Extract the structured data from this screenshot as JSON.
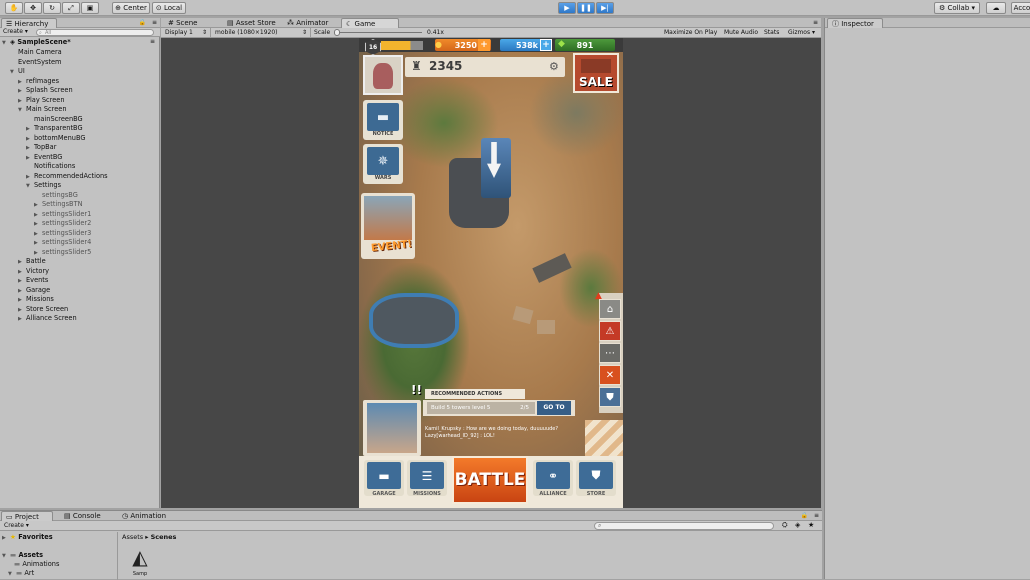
{
  "toolbar": {
    "center_label": "Center",
    "local_label": "Local",
    "collab_label": "Collab",
    "account_label": "Acco"
  },
  "hierarchy": {
    "tab": "Hierarchy",
    "create": "Create",
    "search_placeholder": "All",
    "scene": "SampleScene*",
    "rows": [
      {
        "label": "Main Camera",
        "indent": 1,
        "arrow": ""
      },
      {
        "label": "EventSystem",
        "indent": 1,
        "arrow": ""
      },
      {
        "label": "UI",
        "indent": 1,
        "arrow": "▼"
      },
      {
        "label": "refImages",
        "indent": 2,
        "arrow": "▶"
      },
      {
        "label": "Splash Screen",
        "indent": 2,
        "arrow": "▶"
      },
      {
        "label": "Play Screen",
        "indent": 2,
        "arrow": "▶"
      },
      {
        "label": "Main Screen",
        "indent": 2,
        "arrow": "▼"
      },
      {
        "label": "mainScreenBG",
        "indent": 3,
        "arrow": ""
      },
      {
        "label": "TransparentBG",
        "indent": 3,
        "arrow": "▶"
      },
      {
        "label": "bottomMenuBG",
        "indent": 3,
        "arrow": "▶"
      },
      {
        "label": "TopBar",
        "indent": 3,
        "arrow": "▶"
      },
      {
        "label": "EventBG",
        "indent": 3,
        "arrow": "▶"
      },
      {
        "label": "Notifications",
        "indent": 3,
        "arrow": ""
      },
      {
        "label": "RecommendedActions",
        "indent": 3,
        "arrow": "▶"
      },
      {
        "label": "Settings",
        "indent": 3,
        "arrow": "▼"
      },
      {
        "label": "settingsBG",
        "indent": 4,
        "arrow": ""
      },
      {
        "label": "SettingsBTN",
        "indent": 4,
        "arrow": "▶"
      },
      {
        "label": "settingsSlider1",
        "indent": 4,
        "arrow": "▶"
      },
      {
        "label": "settingsSlider2",
        "indent": 4,
        "arrow": "▶"
      },
      {
        "label": "settingsSlider3",
        "indent": 4,
        "arrow": "▶"
      },
      {
        "label": "settingsSlider4",
        "indent": 4,
        "arrow": "▶"
      },
      {
        "label": "settingsSlider5",
        "indent": 4,
        "arrow": "▶"
      },
      {
        "label": "Battle",
        "indent": 2,
        "arrow": "▶"
      },
      {
        "label": "Victory",
        "indent": 2,
        "arrow": "▶"
      },
      {
        "label": "Events",
        "indent": 2,
        "arrow": "▶"
      },
      {
        "label": "Garage",
        "indent": 2,
        "arrow": "▶"
      },
      {
        "label": "Missions",
        "indent": 2,
        "arrow": "▶"
      },
      {
        "label": "Store Screen",
        "indent": 2,
        "arrow": "▶"
      },
      {
        "label": "Alliance Screen",
        "indent": 2,
        "arrow": "▶"
      }
    ]
  },
  "center_tabs": {
    "scene": "Scene",
    "asset_store": "Asset Store",
    "animator": "Animator",
    "game": "Game"
  },
  "game_toolbar": {
    "display": "Display 1",
    "resolution": "mobile (1080×1920)",
    "scale_label": "Scale",
    "scale_value": "0.41x",
    "maximize": "Maximize On Play",
    "mute": "Mute Audio",
    "stats": "Stats",
    "gizmos": "Gizmos"
  },
  "inspector": {
    "tab": "Inspector"
  },
  "bottom": {
    "project_tab": "Project",
    "console_tab": "Console",
    "animation_tab": "Animation",
    "create": "Create",
    "favorites": "Favorites",
    "assets": "Assets",
    "animations": "Animations",
    "art": "Art",
    "breadcrumb_assets": "Assets",
    "breadcrumb_scenes": "Scenes",
    "scene_file": "Samp"
  },
  "game": {
    "level": "16",
    "coins": "3250",
    "gems": "538k",
    "green": "891",
    "trophies": "2345",
    "sale": "SALE",
    "notice": "NOTICE",
    "wars": "WARS",
    "event": "EVENT!",
    "recommended_title": "RECOMMENDED ACTIONS",
    "recommended_task": "Build 5 towers level 5",
    "recommended_progress": "2/5",
    "goto": "GO TO",
    "chat_line1": "Kamil_Krupsky : How are we doing today, duuuuude?",
    "chat_line2": "Lazy[warhead_ID_92] : LOL!",
    "garage": "GARAGE",
    "missions": "MISSIONS",
    "battle": "BATTLE",
    "alliance": "ALLIANCE",
    "store": "STORE"
  }
}
